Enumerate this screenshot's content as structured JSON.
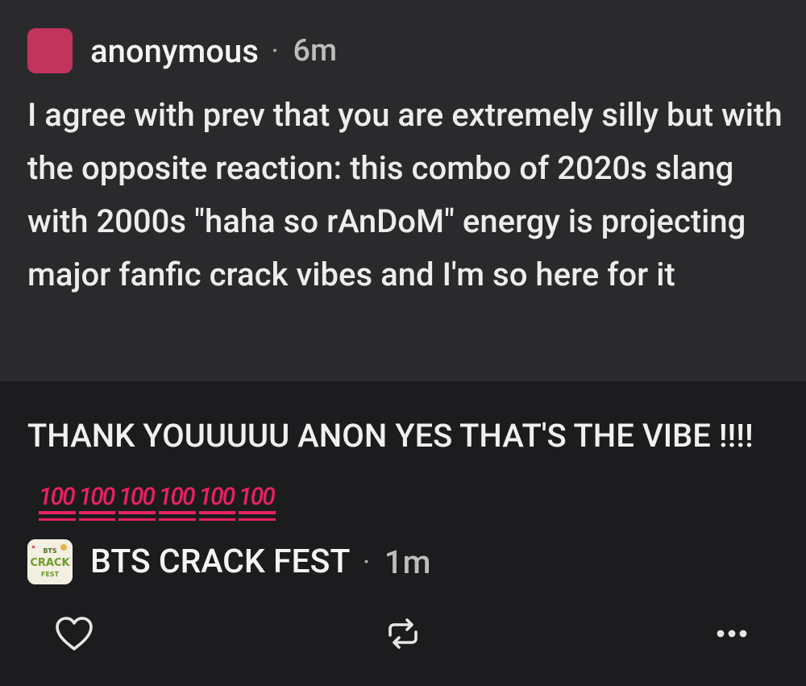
{
  "ask": {
    "asker_name": "anonymous",
    "separator": "·",
    "time": "6m",
    "text": "I agree with prev that you are extremely silly but with the opposite reaction: this combo of 2020s slang with 2000s \"haha so rAnDoM\" energy is projecting major fanfic crack vibes and I'm so here for it"
  },
  "answer": {
    "text": "THANK YOUUUUU ANON YES THAT'S THE VIBE !!!!",
    "emojis": [
      "100",
      "100",
      "100",
      "100",
      "100",
      "100"
    ]
  },
  "blog": {
    "name": "BTS CRACK FEST",
    "separator": "·",
    "time": "1m",
    "avatar_lines": [
      "BTS",
      "CRACK",
      "FEST"
    ]
  },
  "actions": {
    "like_icon": "heart-icon",
    "reblog_icon": "reblog-icon",
    "more_icon": "more-icon"
  },
  "colors": {
    "ask_background": "#2a2a2c",
    "page_background": "#1c1c1e",
    "anon_avatar": "#c2335e",
    "emoji_red": "#e8215f"
  }
}
